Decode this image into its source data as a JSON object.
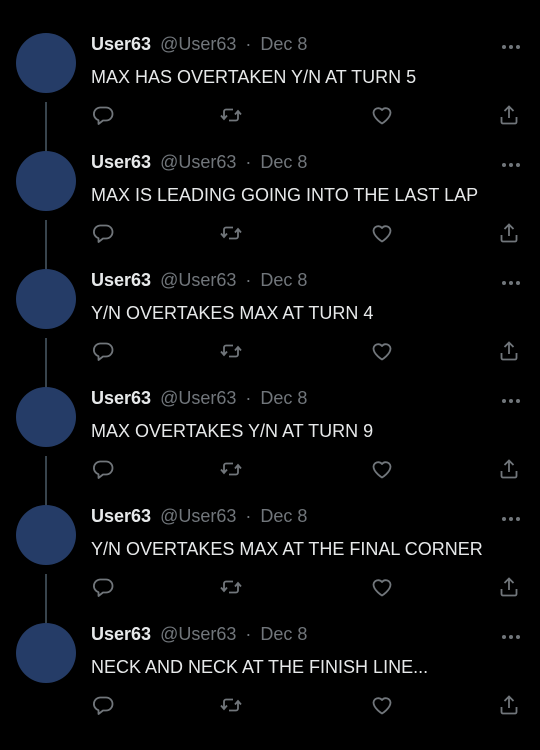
{
  "colors": {
    "background": "#000000",
    "text": "#e7e9ea",
    "secondary": "#71767b",
    "avatar": "#253c67",
    "connector": "#38444d"
  },
  "icons": {
    "more": "more-dots-icon",
    "reply": "reply-icon",
    "retweet": "retweet-icon",
    "like": "heart-icon",
    "share": "share-icon"
  },
  "separator": "·",
  "tweets": [
    {
      "name": "User63",
      "handle": "@User63",
      "date": "Dec 8",
      "text": "MAX HAS OVERTAKEN Y/N AT TURN 5"
    },
    {
      "name": "User63",
      "handle": "@User63",
      "date": "Dec 8",
      "text": "MAX IS LEADING GOING INTO THE LAST LAP"
    },
    {
      "name": "User63",
      "handle": "@User63",
      "date": "Dec 8",
      "text": "Y/N OVERTAKES MAX AT TURN 4"
    },
    {
      "name": "User63",
      "handle": "@User63",
      "date": "Dec 8",
      "text": "MAX OVERTAKES Y/N AT TURN 9"
    },
    {
      "name": "User63",
      "handle": "@User63",
      "date": "Dec 8",
      "text": "Y/N OVERTAKES MAX AT THE FINAL CORNER"
    },
    {
      "name": "User63",
      "handle": "@User63",
      "date": "Dec 8",
      "text": "NECK AND NECK AT THE FINISH LINE..."
    }
  ]
}
